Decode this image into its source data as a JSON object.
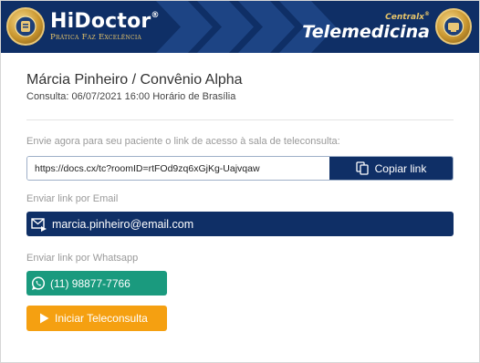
{
  "header": {
    "logo_title": "HiDoctor",
    "logo_mark": "®",
    "logo_tagline": "Prática Faz Excelência",
    "brand_small": "Centralx",
    "brand_mark": "®",
    "product_title": "Telemedicina",
    "colors": {
      "bar": "#0f2f66",
      "chevrons": "#1d4484",
      "gold": "#e7c56a"
    }
  },
  "patient": {
    "name_line": "Márcia Pinheiro / Convênio Alpha",
    "consult_line": "Consulta: 06/07/2021 16:00 Horário de Brasília"
  },
  "link_section": {
    "label": "Envie agora para seu paciente o link de acesso à sala de teleconsulta:",
    "url": "https://docs.cx/tc?roomID=rtFOd9zq6xGjKg-Uajvqaw",
    "copy_label": "Copiar link",
    "copy_icon": "copy-icon"
  },
  "email_section": {
    "label": "Enviar link por Email",
    "email": "marcia.pinheiro@email.com",
    "icon": "email-send-icon"
  },
  "whatsapp_section": {
    "label": "Enviar link por Whatsapp",
    "phone": "(11) 98877-7766",
    "icon": "whatsapp-icon"
  },
  "start_button": {
    "label": "Iniciar Teleconsulta",
    "icon": "play-icon"
  },
  "colors": {
    "primary": "#0f2f66",
    "whatsapp": "#1a9a7e",
    "start": "#f5a011",
    "muted_text": "#9a9a9a"
  }
}
